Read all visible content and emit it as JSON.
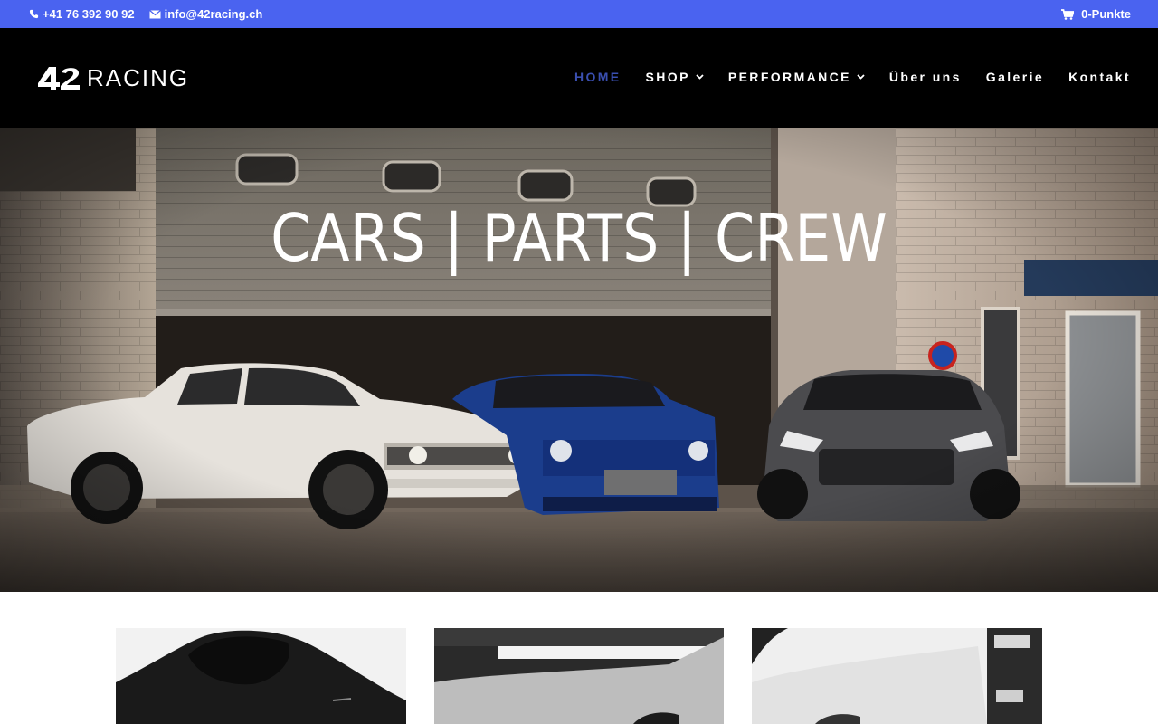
{
  "topbar": {
    "phone": "+41 76 392 90 92",
    "email": "info@42racing.ch",
    "cart": "0-Punkte",
    "color": "#4a63f0"
  },
  "header": {
    "logo_mark": "42",
    "logo_text": "RACING",
    "nav": [
      {
        "label": "HOME",
        "active": true
      },
      {
        "label": "SHOP",
        "dropdown": true
      },
      {
        "label": "PERFORMANCE",
        "dropdown": true
      },
      {
        "label": "Über uns"
      },
      {
        "label": "Galerie"
      },
      {
        "label": "Kontakt"
      }
    ]
  },
  "hero": {
    "title": "CARS | PARTS | CREW"
  },
  "cards": [
    {
      "icon": "hoodie-image"
    },
    {
      "icon": "garage-car-image"
    },
    {
      "icon": "car-detail-image"
    }
  ]
}
